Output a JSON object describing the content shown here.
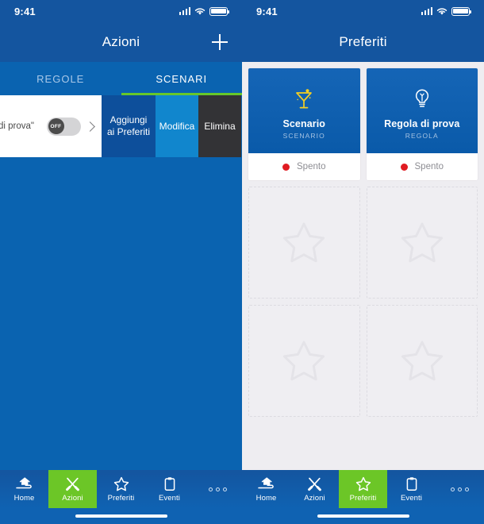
{
  "left": {
    "status": {
      "time": "9:41",
      "signal_icon": "cellular-signal-icon",
      "wifi_icon": "wifi-icon",
      "battery_icon": "battery-icon"
    },
    "nav": {
      "title": "Azioni",
      "add_icon": "plus-icon"
    },
    "tabs": [
      {
        "label": "REGOLE",
        "active": false
      },
      {
        "label": "SCENARI",
        "active": true
      }
    ],
    "row": {
      "label": "di prova\"",
      "toggle_state": "OFF",
      "chevron_icon": "chevron-right-icon",
      "actions": [
        {
          "label": "Aggiungi ai Preferiti",
          "color": "#0d4f9b"
        },
        {
          "label": "Modifica",
          "color": "#1186cd"
        },
        {
          "label": "Elimina",
          "color": "#333336"
        }
      ]
    },
    "tabbar": [
      {
        "label": "Home",
        "icon": "hand-house-icon",
        "active": false
      },
      {
        "label": "Azioni",
        "icon": "tools-icon",
        "active": true
      },
      {
        "label": "Preferiti",
        "icon": "star-icon",
        "active": false
      },
      {
        "label": "Eventi",
        "icon": "clipboard-icon",
        "active": false
      }
    ],
    "more_icon": "more-dots-icon"
  },
  "right": {
    "status": {
      "time": "9:41",
      "signal_icon": "cellular-signal-icon",
      "wifi_icon": "wifi-icon",
      "battery_icon": "battery-icon"
    },
    "nav": {
      "title": "Preferiti"
    },
    "favorites": [
      {
        "name": "Scenario",
        "kind": "SCENARIO",
        "icon": "cocktail-icon",
        "status": "Spento",
        "status_color": "#e01b22"
      },
      {
        "name": "Regola di prova",
        "kind": "REGOLA",
        "icon": "lightbulb-icon",
        "status": "Spento",
        "status_color": "#e01b22"
      }
    ],
    "empty_slots": 4,
    "empty_icon": "star-outline-icon",
    "tabbar": [
      {
        "label": "Home",
        "icon": "hand-house-icon",
        "active": false
      },
      {
        "label": "Azioni",
        "icon": "tools-icon",
        "active": false
      },
      {
        "label": "Preferiti",
        "icon": "star-icon",
        "active": true
      },
      {
        "label": "Eventi",
        "icon": "clipboard-icon",
        "active": false
      }
    ],
    "more_icon": "more-dots-icon"
  },
  "theme": {
    "nav_blue": "#14559f",
    "body_blue": "#0a63b0",
    "accent_green": "#6cc627",
    "panel_gray": "#eeedf1"
  }
}
